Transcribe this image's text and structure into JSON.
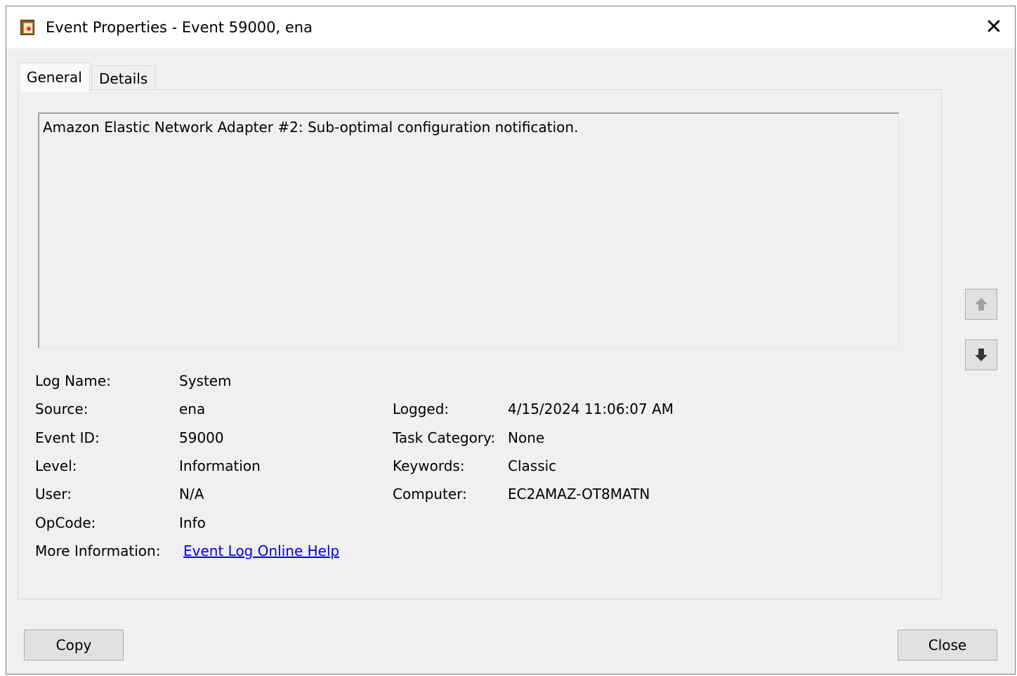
{
  "window": {
    "title": "Event Properties - Event 59000, ena",
    "close_glyph": "✕"
  },
  "tabs": [
    {
      "label": "General",
      "active": true
    },
    {
      "label": "Details",
      "active": false
    }
  ],
  "message": "Amazon Elastic Network Adapter #2: Sub-optimal configuration notification.",
  "fields": {
    "log_name": {
      "label": "Log Name:",
      "value": "System"
    },
    "source": {
      "label": "Source:",
      "value": "ena"
    },
    "event_id": {
      "label": "Event ID:",
      "value": "59000"
    },
    "level": {
      "label": "Level:",
      "value": "Information"
    },
    "user": {
      "label": "User:",
      "value": "N/A"
    },
    "opcode": {
      "label": "OpCode:",
      "value": "Info"
    },
    "more_info": {
      "label": "More Information:",
      "value": "Event Log Online Help"
    },
    "logged": {
      "label": "Logged:",
      "value": "4/15/2024 11:06:07 AM"
    },
    "task_category": {
      "label": "Task Category:",
      "value": "None"
    },
    "keywords": {
      "label": "Keywords:",
      "value": "Classic"
    },
    "computer": {
      "label": "Computer:",
      "value": "EC2AMAZ-OT8MATN"
    }
  },
  "buttons": {
    "copy": "Copy",
    "close": "Close"
  },
  "icons": {
    "title": "event-viewer-icon",
    "up": "arrow-up-icon",
    "down": "arrow-down-icon",
    "close": "close-icon"
  },
  "colors": {
    "link": "#0000ee",
    "dialog_bg": "#f0f0f0",
    "disabled_arrow": "#a0a0a0",
    "enabled_arrow": "#333333"
  }
}
